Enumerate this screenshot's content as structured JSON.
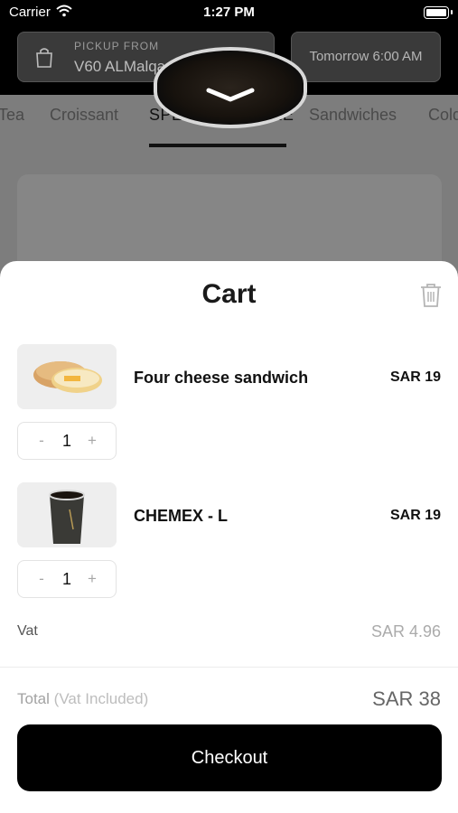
{
  "status_bar": {
    "carrier": "Carrier",
    "time": "1:27 PM"
  },
  "header": {
    "pickup_caption": "PICKUP FROM",
    "pickup_store": "V60  ALMalqa",
    "schedule": "Tomorrow 6:00 AM"
  },
  "tabs": [
    {
      "label": "Tea",
      "active": false
    },
    {
      "label": "Croissant",
      "active": false
    },
    {
      "label": "SPECIAL COFFEE",
      "active": true
    },
    {
      "label": "Sandwiches",
      "active": false
    },
    {
      "label": "Cold",
      "active": false
    }
  ],
  "cart": {
    "title": "Cart",
    "items": [
      {
        "name": "Four cheese sandwich",
        "price": "SAR 19",
        "quantity": "1",
        "minus": "-",
        "plus": "+"
      },
      {
        "name": "CHEMEX - L",
        "price": "SAR 19",
        "quantity": "1",
        "minus": "-",
        "plus": "+"
      }
    ],
    "vat_label": "Vat",
    "vat_value": "SAR 4.96",
    "total_label": "Total",
    "total_sub": "(Vat Included)",
    "total_value": "SAR 38",
    "checkout_label": "Checkout"
  },
  "icons": {
    "wifi": "wifi-icon",
    "battery": "battery-icon",
    "bag": "shopping-bag-icon",
    "chevron": "chevron-down-icon",
    "trash": "trash-icon"
  },
  "colors": {
    "accent": "#000000",
    "sheet_background": "#ffffff",
    "dim_overlay": "#7d7d7d"
  }
}
